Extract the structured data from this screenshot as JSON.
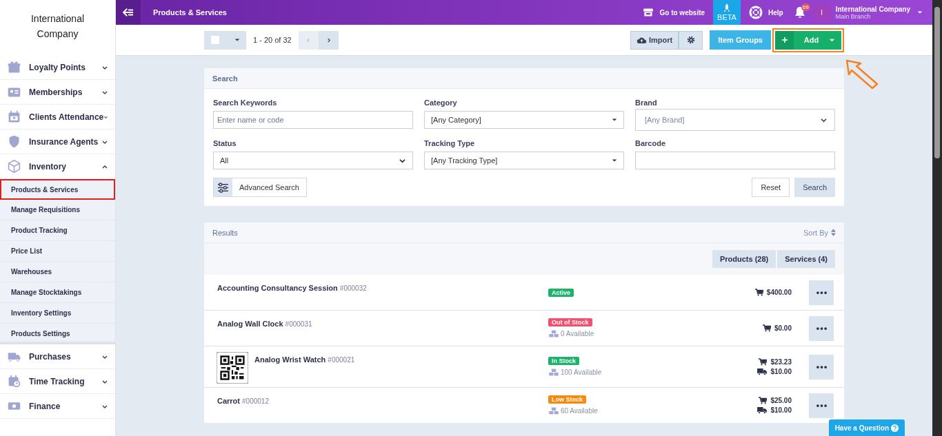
{
  "company": {
    "name": "International Company"
  },
  "sidebar": {
    "items": [
      {
        "label": "Loyalty Points",
        "kind": "gift",
        "expanded": false
      },
      {
        "label": "Memberships",
        "kind": "id-card",
        "expanded": false
      },
      {
        "label": "Clients Attendance",
        "kind": "calendar",
        "expanded": false
      },
      {
        "label": "Insurance Agents",
        "kind": "shield",
        "expanded": false
      },
      {
        "label": "Inventory",
        "kind": "box",
        "expanded": true,
        "children": [
          {
            "label": "Products & Services",
            "selected": true
          },
          {
            "label": "Manage Requisitions",
            "selected": false
          },
          {
            "label": "Product Tracking",
            "selected": false
          },
          {
            "label": "Price List",
            "selected": false
          },
          {
            "label": "Warehouses",
            "selected": false
          },
          {
            "label": "Manage Stocktakings",
            "selected": false
          },
          {
            "label": "Inventory Settings",
            "selected": false
          },
          {
            "label": "Products Settings",
            "selected": false
          }
        ]
      },
      {
        "label": "Purchases",
        "kind": "truck",
        "expanded": false
      },
      {
        "label": "Time Tracking",
        "kind": "calendar-clock",
        "expanded": false
      },
      {
        "label": "Finance",
        "kind": "money",
        "expanded": false
      }
    ]
  },
  "topbar": {
    "title": "Products & Services",
    "website_link": "Go to website",
    "beta": "BETA",
    "help": "Help",
    "notification_count": "69",
    "user": {
      "initial": "I",
      "name": "International Company",
      "branch": "Main Branch"
    }
  },
  "toolbar": {
    "select_all_checked": false,
    "range": "1 - 20 of 32",
    "prev_disabled": true,
    "import": "Import",
    "item_groups": "Item Groups",
    "add": "Add",
    "add_highlighted": true
  },
  "search": {
    "title": "Search",
    "fields": [
      {
        "label": "Search Keywords",
        "kind": "text",
        "placeholder": "Enter name or code"
      },
      {
        "label": "Category",
        "kind": "combo",
        "value": "[Any Category]"
      },
      {
        "label": "Brand",
        "kind": "light",
        "value": "[Any Brand]"
      },
      {
        "label": "Status",
        "kind": "native",
        "value": "All"
      },
      {
        "label": "Tracking Type",
        "kind": "combo",
        "value": "[Any Tracking Type]"
      },
      {
        "label": "Barcode",
        "kind": "text"
      }
    ],
    "advanced": "Advanced Search",
    "reset": "Reset",
    "submit": "Search"
  },
  "results": {
    "title": "Results",
    "sort": "Sort By",
    "tabs": [
      "Products (28)",
      "Services (4)"
    ],
    "rows": [
      {
        "kind": "plain",
        "name": "Accounting Consultancy Session",
        "code": "#000032",
        "status": {
          "label": "Active",
          "color": "#1db36b"
        },
        "prices": [
          {
            "kind": "sell",
            "value": "$400.00"
          }
        ]
      },
      {
        "kind": "plain",
        "name": "Analog Wall Clock",
        "code": "#000031",
        "status": {
          "label": "Out of Stock",
          "color": "#f2506e"
        },
        "available": "0 Available",
        "prices": [
          {
            "kind": "sell",
            "value": "$0.00"
          }
        ]
      },
      {
        "kind": "qr-thumbnail",
        "name": "Analog Wrist Watch",
        "code": "#000021",
        "status": {
          "label": "In Stock",
          "color": "#1db36b"
        },
        "available": "100 Available",
        "prices": [
          {
            "kind": "sell",
            "value": "$23.23"
          },
          {
            "kind": "buy",
            "value": "$10.00"
          }
        ]
      },
      {
        "kind": "plain",
        "name": "Carrot",
        "code": "#000012",
        "status": {
          "label": "Low Stock",
          "color": "#f7890f"
        },
        "available": "60 Available",
        "prices": [
          {
            "kind": "sell",
            "value": "$25.00"
          },
          {
            "kind": "buy",
            "value": "$10.00"
          }
        ]
      }
    ]
  },
  "help_button": "Have a Question"
}
